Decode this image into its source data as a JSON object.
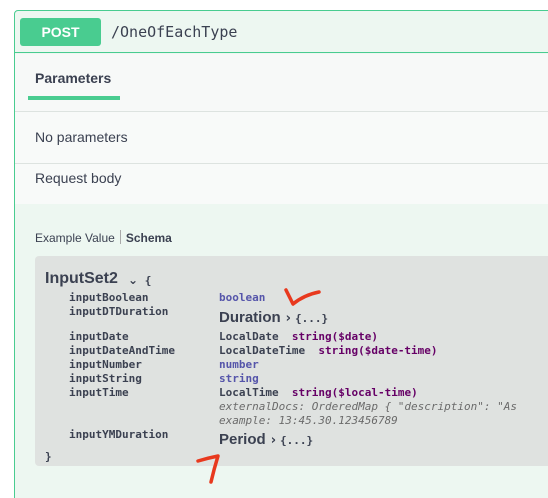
{
  "operation": {
    "method": "POST",
    "path": "/OneOfEachType"
  },
  "parameters": {
    "tab_label": "Parameters",
    "empty_text": "No parameters"
  },
  "request_body": {
    "label": "Request body",
    "tabs": {
      "example": "Example Value",
      "schema": "Schema"
    }
  },
  "model": {
    "name": "InputSet2",
    "open_brace": "{",
    "close_brace": "}",
    "properties": [
      {
        "name": "inputBoolean",
        "type": "boolean"
      },
      {
        "name": "inputDTDuration",
        "model": "Duration",
        "collapsed": "{...}"
      },
      {
        "name": "inputDate",
        "type": "LocalDate",
        "format": "string($date)"
      },
      {
        "name": "inputDateAndTime",
        "type": "LocalDateTime",
        "format": "string($date-time)"
      },
      {
        "name": "inputNumber",
        "type": "number"
      },
      {
        "name": "inputString",
        "type": "string"
      },
      {
        "name": "inputTime",
        "type": "LocalTime",
        "format": "string($local-time)",
        "external_docs": "externalDocs: OrderedMap { \"description\": \"As",
        "example": "example: 13:45.30.123456789"
      },
      {
        "name": "inputYMDuration",
        "model": "Period",
        "collapsed": "{...}"
      }
    ]
  },
  "annotations": {
    "color": "#e8391e"
  },
  "colors": {
    "accent": "#49cc90",
    "background": "#edf7f1",
    "model_bg": "#dfe2e0"
  }
}
